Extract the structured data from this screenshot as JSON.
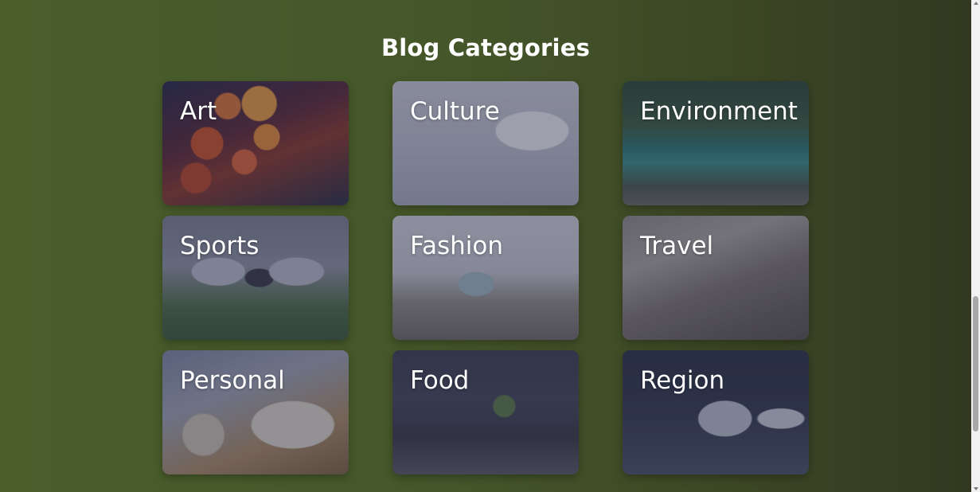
{
  "header": {
    "title": "Blog Categories"
  },
  "categories": [
    {
      "label": "Art",
      "image": "lanterns-photo"
    },
    {
      "label": "Culture",
      "image": "woman-desk-photo"
    },
    {
      "label": "Environment",
      "image": "river-forest-photo"
    },
    {
      "label": "Sports",
      "image": "football-players-photo"
    },
    {
      "label": "Fashion",
      "image": "woman-laptop-photo"
    },
    {
      "label": "Travel",
      "image": "stone-houses-photo"
    },
    {
      "label": "Personal",
      "image": "coffee-notebook-photo"
    },
    {
      "label": "Food",
      "image": "food-table-photo"
    },
    {
      "label": "Region",
      "image": "person-laptop-photo"
    }
  ],
  "colors": {
    "background_start": "#4a5e2c",
    "background_end": "#313820",
    "text": "#ffffff",
    "card_overlay": "#23263c"
  }
}
